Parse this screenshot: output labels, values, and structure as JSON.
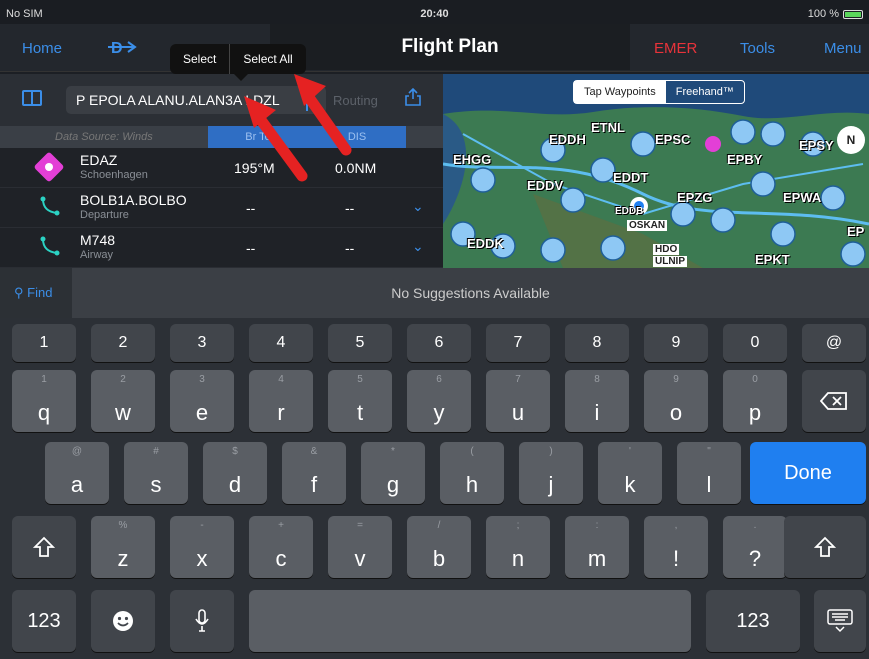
{
  "status": {
    "carrier": "No SIM",
    "time": "20:40",
    "battery": "100 %"
  },
  "nav": {
    "home": "Home",
    "title": "Flight Plan",
    "emer": "EMER",
    "tools": "Tools",
    "menu": "Menu"
  },
  "edit_menu": {
    "select": "Select",
    "select_all": "Select All"
  },
  "route": {
    "text": "P EPOLA ALANU.ALAN3A LDZL",
    "routing_label": "Routing"
  },
  "table": {
    "data_source": "Data Source: Winds",
    "col_bearing": "Br To",
    "col_dis": "DIS",
    "rows": [
      {
        "name": "EDAZ",
        "sub": "Schoenhagen",
        "bearing": "195°M",
        "distance": "0.0NM"
      },
      {
        "name": "BOLB1A.BOLBO",
        "sub": "Departure",
        "bearing": "--",
        "distance": "--"
      },
      {
        "name": "M748",
        "sub": "Airway",
        "bearing": "--",
        "distance": "--"
      }
    ]
  },
  "map": {
    "tap_waypoints": "Tap Waypoints",
    "freehand": "Freehand™",
    "labels": [
      "ETNL",
      "EDDH",
      "EPSC",
      "EPBY",
      "EPSY",
      "EHGG",
      "EDDV",
      "EDDT",
      "EPZG",
      "EPWA",
      "EDDB",
      "OSKAN",
      "HDO",
      "ULNIP",
      "EPKT",
      "EDDK",
      "EP"
    ],
    "compass": "N"
  },
  "find": {
    "label": "Find",
    "suggestion": "No Suggestions Available"
  },
  "keyboard": {
    "numbers": [
      "1",
      "2",
      "3",
      "4",
      "5",
      "6",
      "7",
      "8",
      "9",
      "0",
      "@"
    ],
    "row1": [
      [
        "q",
        "1"
      ],
      [
        "w",
        "2"
      ],
      [
        "e",
        "3"
      ],
      [
        "r",
        "4"
      ],
      [
        "t",
        "5"
      ],
      [
        "y",
        "6"
      ],
      [
        "u",
        "7"
      ],
      [
        "i",
        "8"
      ],
      [
        "o",
        "9"
      ],
      [
        "p",
        "0"
      ]
    ],
    "row2": [
      [
        "a",
        "@"
      ],
      [
        "s",
        "#"
      ],
      [
        "d",
        "$"
      ],
      [
        "f",
        "&"
      ],
      [
        "g",
        "*"
      ],
      [
        "h",
        "("
      ],
      [
        "j",
        ")"
      ],
      [
        "k",
        "'"
      ],
      [
        "l",
        "\""
      ]
    ],
    "row3": [
      [
        "z",
        "%"
      ],
      [
        "x",
        "-"
      ],
      [
        "c",
        "+"
      ],
      [
        "v",
        "="
      ],
      [
        "b",
        "/"
      ],
      [
        "n",
        ";"
      ],
      [
        "m",
        ":"
      ],
      [
        "!",
        ","
      ],
      [
        "?",
        "."
      ]
    ],
    "done": "Done",
    "num_toggle": "123"
  },
  "colors": {
    "accent": "#3b8ee8",
    "emer": "#e8333a",
    "done": "#1f7ff0",
    "arrow": "#e52222"
  }
}
